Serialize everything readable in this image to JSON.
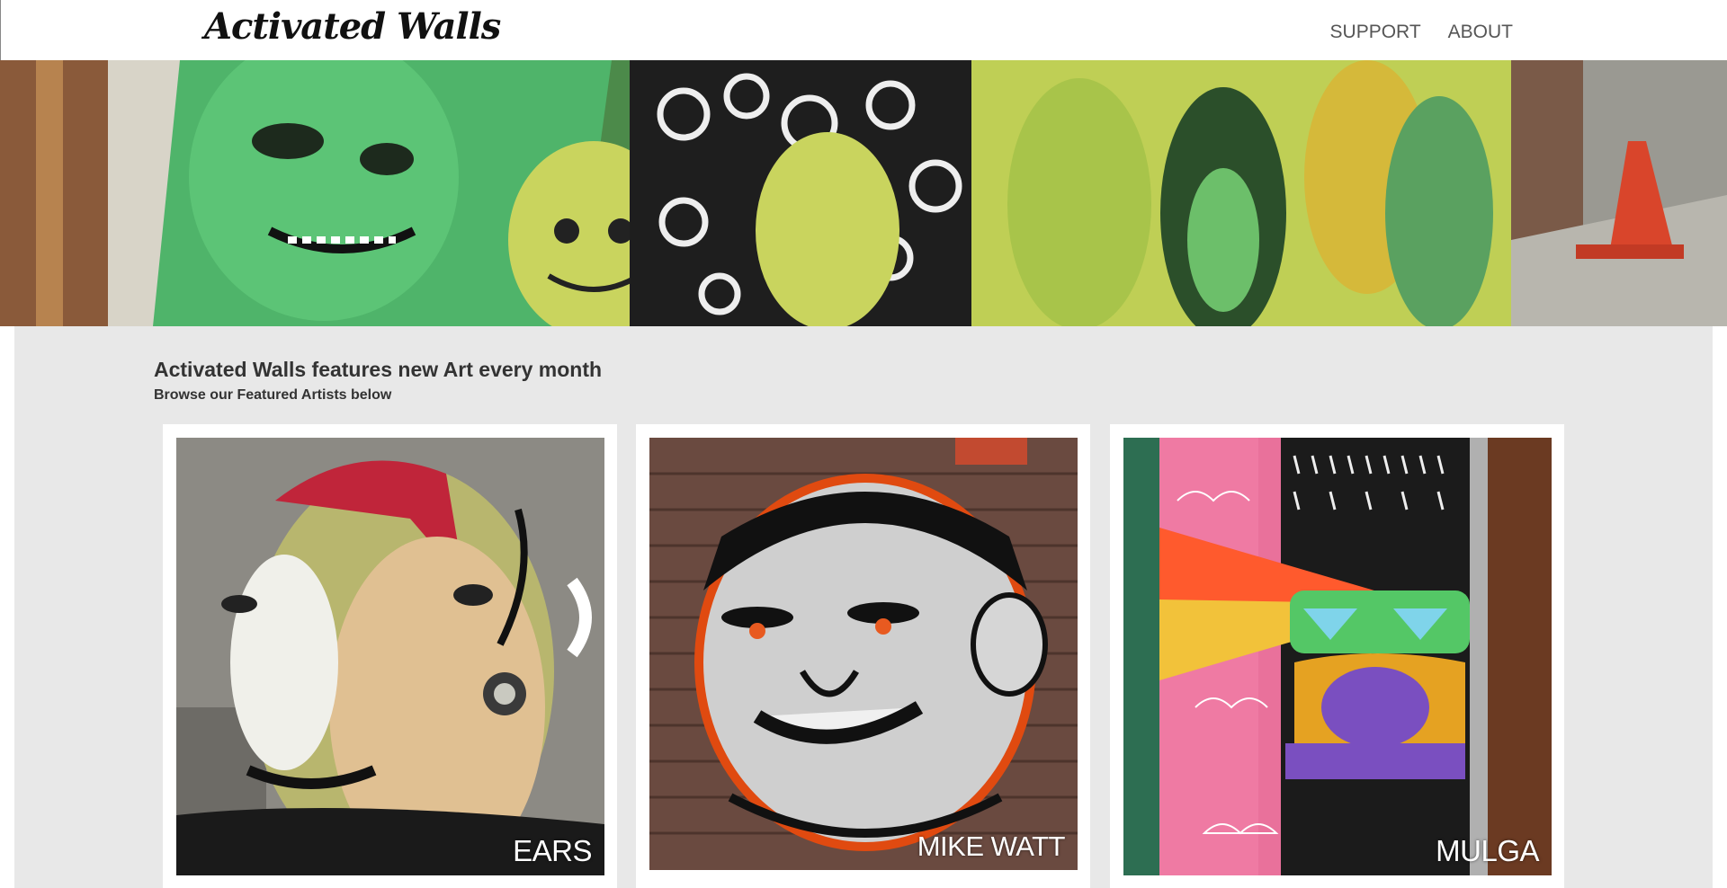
{
  "header": {
    "logo_text": "Activated Walls",
    "nav": [
      {
        "label": "SUPPORT"
      },
      {
        "label": "ABOUT"
      }
    ]
  },
  "intro": {
    "headline": "Activated Walls features new Art every month",
    "subhead": "Browse our Featured Artists below"
  },
  "artists": [
    {
      "name": "EARS"
    },
    {
      "name": "MIKE WATT"
    },
    {
      "name": "MULGA"
    }
  ],
  "colors": {
    "background": "#e8e8e8",
    "header_bg": "#ffffff",
    "nav_text": "#555555",
    "headline_text": "#333333"
  }
}
